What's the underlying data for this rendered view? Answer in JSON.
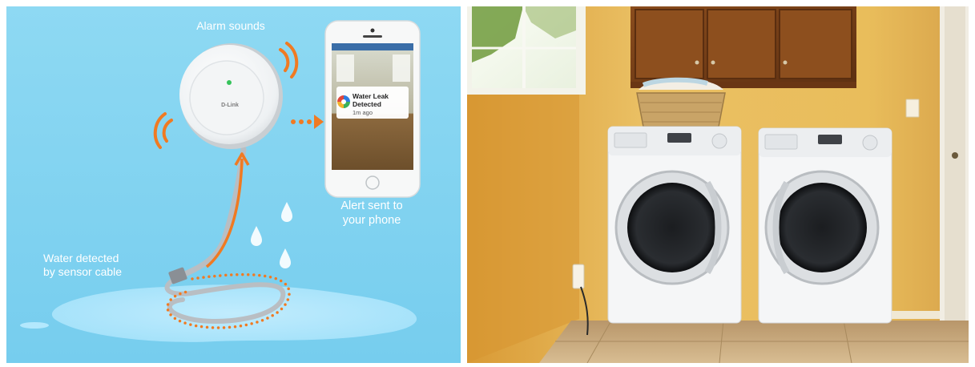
{
  "infographic": {
    "alarm_label": "Alarm sounds",
    "alert_label_line1": "Alert sent to",
    "alert_label_line2": "your phone",
    "water_label_line1": "Water detected",
    "water_label_line2": "by sensor cable",
    "device_brand": "D-Link",
    "phone_notification_title_line1": "Water Leak",
    "phone_notification_title_line2": "Detected",
    "phone_notification_time": "1m ago"
  },
  "photo": {
    "subject": "laundry room with two front-load washer and dryer units"
  },
  "colors": {
    "infographic_background": "#7fd3f0",
    "accent_orange": "#f07a22",
    "wall": "#e6b455",
    "cabinet": "#7a4218",
    "floor": "#c7a77c"
  },
  "icons": [
    "sound-waves-icon",
    "arrow-right-icon",
    "arrow-up-icon",
    "water-drop-icon",
    "notification-app-icon"
  ]
}
